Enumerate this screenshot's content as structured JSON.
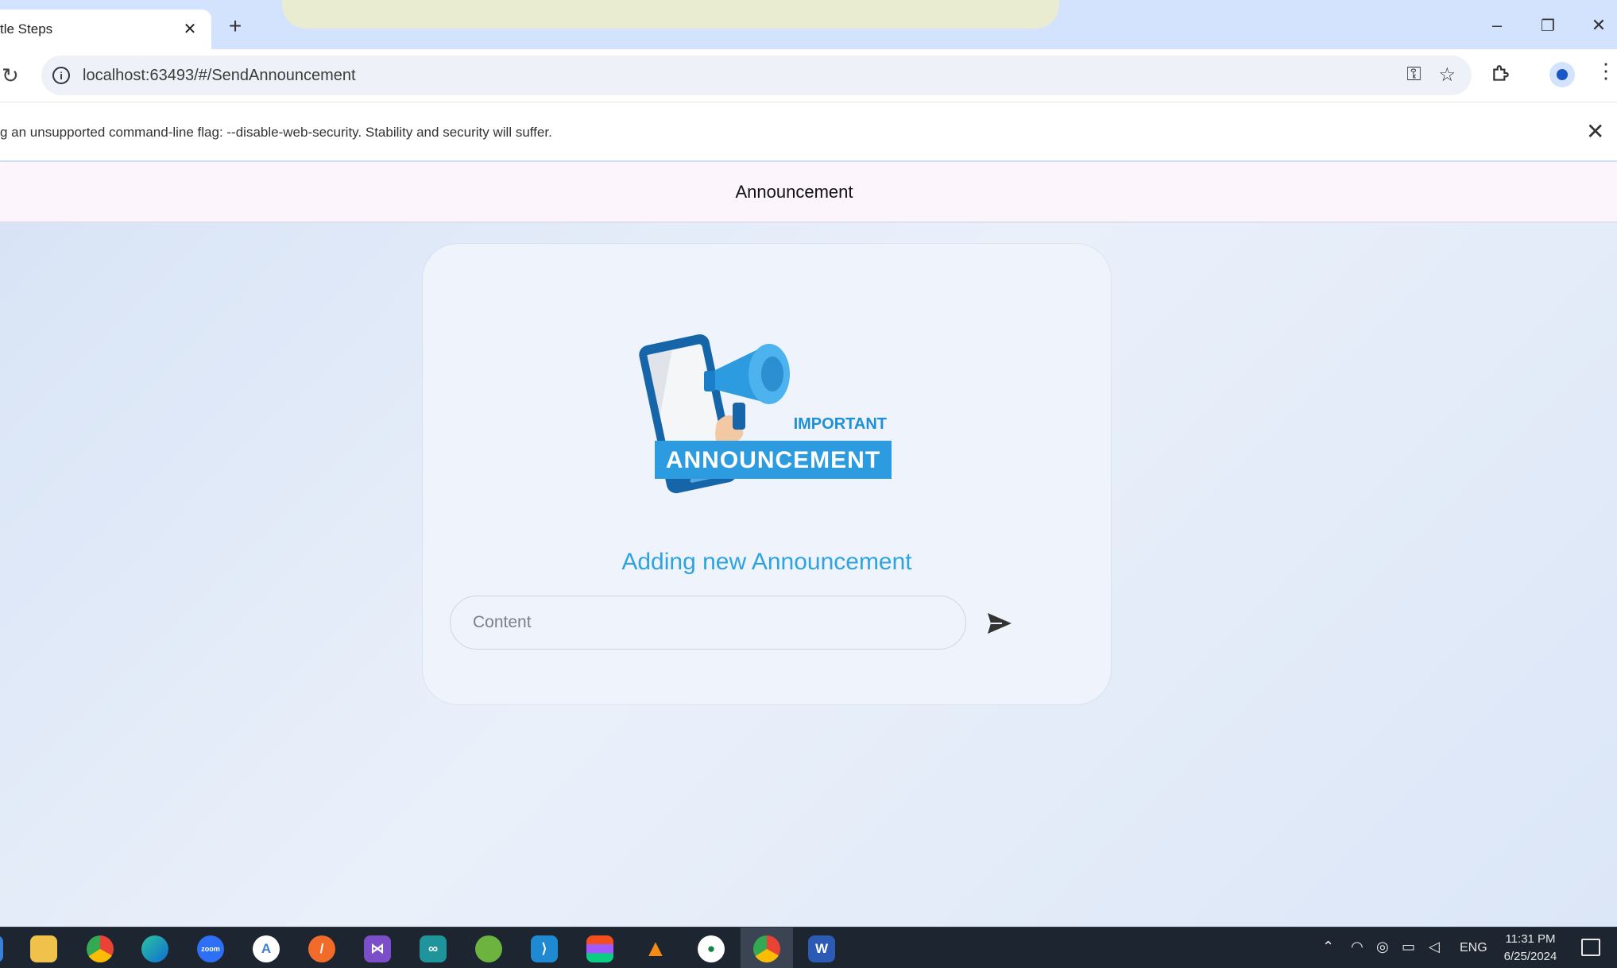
{
  "browser": {
    "tab_title": "tle Steps",
    "tab_close": "✕",
    "new_tab": "+",
    "url": "localhost:63493/#/SendAnnouncement",
    "window_controls": {
      "minimize": "–",
      "restore": "❐",
      "close": "✕"
    }
  },
  "infobar": {
    "message": "g an unsupported command-line flag: --disable-web-security. Stability and security will suffer.",
    "close": "✕"
  },
  "appbar": {
    "title": "Announcement"
  },
  "card": {
    "illustration": {
      "line1": "IMPORTANT",
      "line2": "ANNOUNCEMENT"
    },
    "title": "Adding new Announcement",
    "content_placeholder": "Content",
    "content_value": ""
  },
  "taskbar": {
    "apps": [
      "windows-icon",
      "file-explorer-icon",
      "chrome-icon",
      "edge-icon",
      "zoom-icon",
      "android-studio-icon",
      "postman-icon",
      "visual-studio-icon",
      "arduino-icon",
      "spring-icon",
      "vscode-icon",
      "figma-icon",
      "vlc-icon",
      "mongodb-compass-icon",
      "chrome-icon",
      "word-icon"
    ],
    "language": "ENG",
    "time": "11:31 PM",
    "date": "6/25/2024"
  },
  "colors": {
    "accent": "#2ea3e0",
    "appbar_bg": "#fcf6fc",
    "card_bg": "#eef3fc",
    "taskbar_bg": "#1d2530"
  }
}
